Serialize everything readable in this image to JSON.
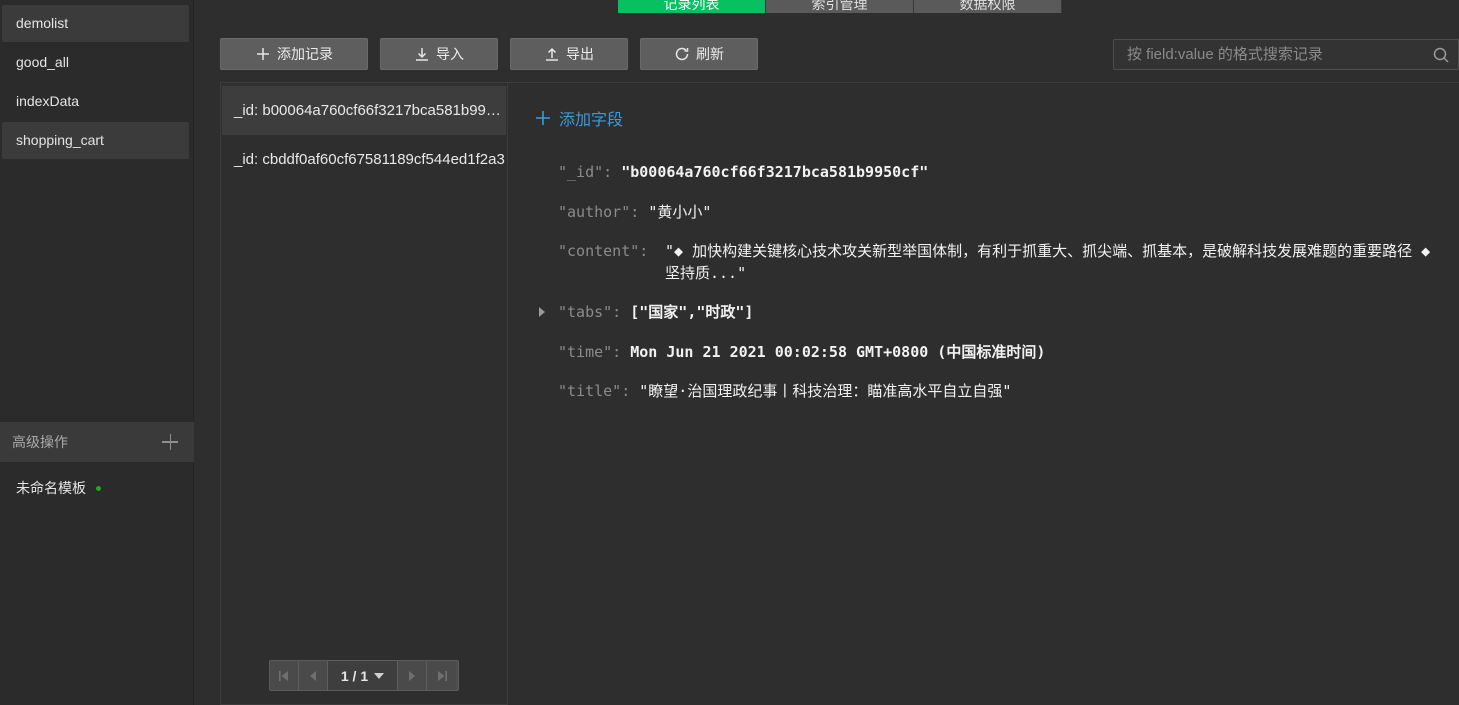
{
  "tabs": [
    "记录列表",
    "索引管理",
    "数据权限"
  ],
  "collections": [
    {
      "name": "demolist"
    },
    {
      "name": "good_all"
    },
    {
      "name": "indexData"
    },
    {
      "name": "shopping_cart"
    }
  ],
  "advanced": {
    "title": "高级操作",
    "template": "未命名模板"
  },
  "toolbar": {
    "add_label": "添加记录",
    "import_label": "导入",
    "export_label": "导出",
    "refresh_label": "刷新"
  },
  "search": {
    "placeholder": "按 field:value 的格式搜索记录"
  },
  "records": [
    "_id: b00064a760cf66f3217bca581b9950cf",
    "_id: cbddf0af60cf67581189cf544ed1f2a3"
  ],
  "pager": {
    "label": "1 / 1"
  },
  "detail": {
    "add_field_label": "添加字段",
    "fields": {
      "id": {
        "key": "\"_id\":",
        "value": "\"b00064a760cf66f3217bca581b9950cf\""
      },
      "author": {
        "key": "\"author\":",
        "value": "\"黄小小\""
      },
      "content": {
        "key": "\"content\":",
        "value": "\"◆ 加快构建关键核心技术攻关新型举国体制，有利于抓重大、抓尖端、抓基本，是破解科技发展难题的重要路径 ◆ 坚持质...\""
      },
      "tabs": {
        "key": "\"tabs\":",
        "value": "[\"国家\",\"时政\"]"
      },
      "time": {
        "key": "\"time\":",
        "value": "Mon Jun 21 2021 00:02:58 GMT+0800 (中国标准时间)"
      },
      "title": {
        "key": "\"title\":",
        "value": "\"瞭望·治国理政纪事丨科技治理：瞄准高水平自立自强\""
      }
    }
  },
  "colors": {
    "accent_green": "#07c160",
    "link_blue": "#3a9bdc",
    "background": "#2e2e2e"
  }
}
